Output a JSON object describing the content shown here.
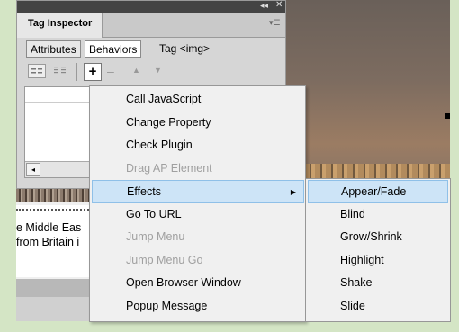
{
  "panel": {
    "title": "Tag Inspector",
    "collapse_glyph": "◂◂",
    "close_glyph": "✕",
    "menu_glyph": "▾☰",
    "subtabs": [
      "Attributes",
      "Behaviors"
    ],
    "tag_label": "Tag <img>",
    "toolbar": {
      "show_set_icon": "show-set-events-icon",
      "show_all_icon": "show-all-events-icon",
      "add_label": "+",
      "remove_label": "–",
      "up_label": "▲",
      "down_label": "▼"
    },
    "scroll_left_glyph": "◂"
  },
  "document": {
    "text_line1": "e Middle Eas",
    "text_line2": "from Britain i"
  },
  "menu": {
    "items": [
      {
        "label": "Call JavaScript",
        "enabled": true
      },
      {
        "label": "Change Property",
        "enabled": true
      },
      {
        "label": "Check Plugin",
        "enabled": true
      },
      {
        "label": "Drag AP Element",
        "enabled": false
      },
      {
        "label": "Effects",
        "enabled": true,
        "highlighted": true,
        "submenu_arrow": "▶"
      },
      {
        "label": "Go To URL",
        "enabled": true
      },
      {
        "label": "Jump Menu",
        "enabled": false
      },
      {
        "label": "Jump Menu Go",
        "enabled": false
      },
      {
        "label": "Open Browser Window",
        "enabled": true
      },
      {
        "label": "Popup Message",
        "enabled": true
      }
    ]
  },
  "submenu": {
    "items": [
      {
        "label": "Appear/Fade",
        "highlighted": true
      },
      {
        "label": "Blind"
      },
      {
        "label": "Grow/Shrink"
      },
      {
        "label": "Highlight"
      },
      {
        "label": "Shake"
      },
      {
        "label": "Slide"
      }
    ]
  },
  "colors": {
    "background": "#d4e5c5",
    "highlight": "#cde4f7",
    "disabled_text": "#a0a0a0"
  }
}
